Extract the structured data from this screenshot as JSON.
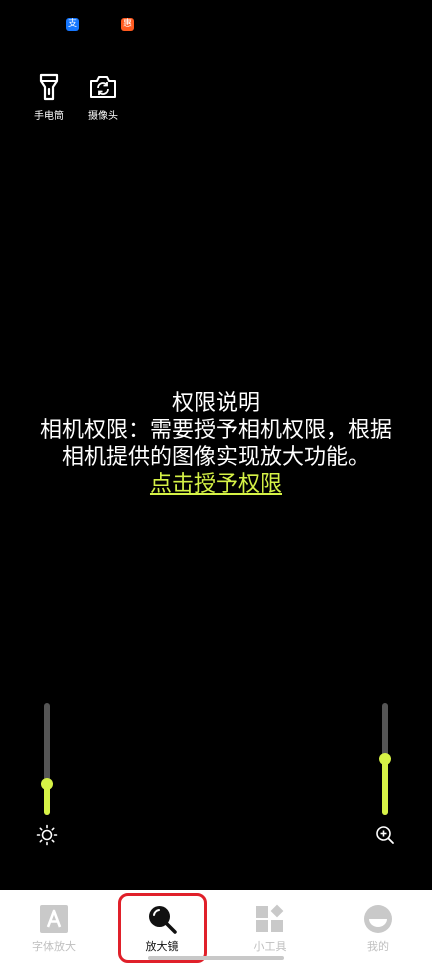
{
  "status_bar": {
    "icons": [
      {
        "name": "alipay-icon",
        "glyph": "支",
        "color": "#1677ff"
      },
      {
        "name": "app-notification-icon",
        "glyph": "惠",
        "color": "#ff5a1f"
      }
    ]
  },
  "tools": {
    "flashlight_label": "手电筒",
    "camera_label": "摄像头"
  },
  "permission": {
    "title": "权限说明",
    "line1": "相机权限：需要授予相机权限，根据",
    "line2": "相机提供的图像实现放大功能。",
    "link": "点击授予权限"
  },
  "sliders": {
    "brightness_level": 0.28,
    "zoom_level": 0.5
  },
  "colors": {
    "accent": "#d6f246",
    "highlight": "#e0202a",
    "background": "#000000"
  },
  "nav": {
    "items": [
      {
        "label": "字体放大",
        "icon": "font-size-icon"
      },
      {
        "label": "放大镜",
        "icon": "magnifier-icon"
      },
      {
        "label": "小工具",
        "icon": "widgets-icon"
      },
      {
        "label": "我的",
        "icon": "profile-icon"
      }
    ],
    "active_index": 1
  }
}
